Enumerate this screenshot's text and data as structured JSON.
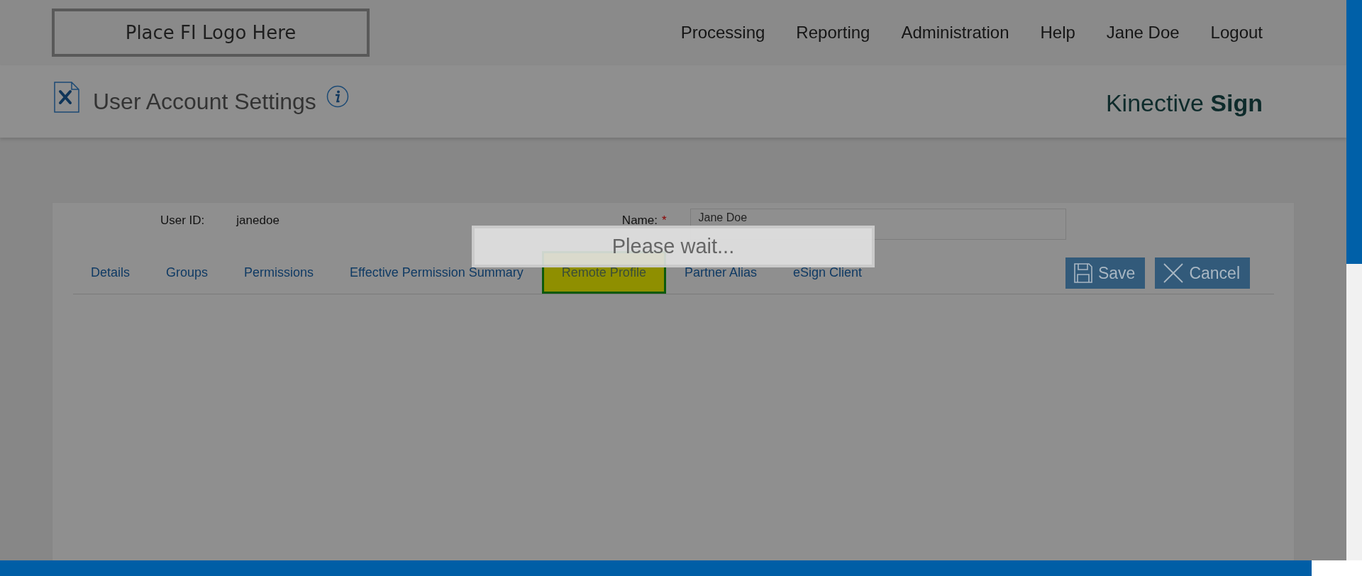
{
  "header": {
    "logo_text": "Place FI Logo Here",
    "nav": [
      {
        "label": "Processing"
      },
      {
        "label": "Reporting"
      },
      {
        "label": "Administration"
      },
      {
        "label": "Help"
      },
      {
        "label": "Jane Doe"
      },
      {
        "label": "Logout"
      }
    ]
  },
  "page": {
    "title": "User Account Settings",
    "brand": "Kinective **Sign**"
  },
  "form": {
    "user_id_label": "User ID:",
    "user_id_value": "janedoe",
    "name_label": "Name:",
    "required_mark": "*",
    "name_value": "Jane Doe"
  },
  "tabs": [
    {
      "label": "Details",
      "selected": false
    },
    {
      "label": "Groups",
      "selected": false
    },
    {
      "label": "Permissions",
      "selected": false
    },
    {
      "label": "Effective Permission Summary",
      "selected": false
    },
    {
      "label": "Remote Profile",
      "selected": true
    },
    {
      "label": "Partner Alias",
      "selected": false
    },
    {
      "label": "eSign Client",
      "selected": false
    }
  ],
  "buttons": [
    {
      "kind": "save",
      "label": "Save"
    },
    {
      "kind": "cancel",
      "label": "Cancel"
    }
  ],
  "loading": {
    "message": "Please wait..."
  }
}
